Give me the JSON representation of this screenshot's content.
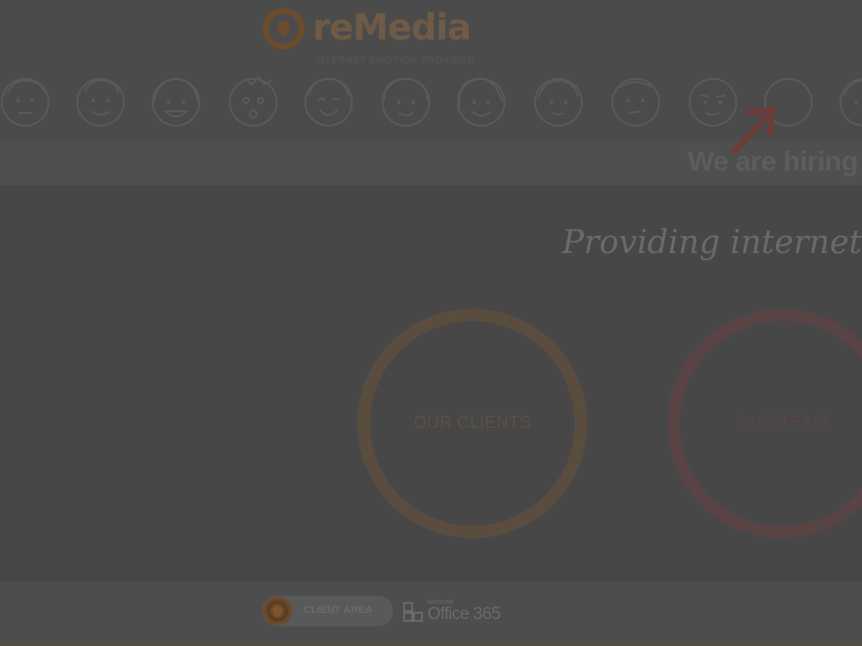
{
  "brand": {
    "name": "reMedia",
    "tagline": "INTERNET EMOTION PROVIDER",
    "accent_color": "#d0701a",
    "logo_icon": "remedia-logo-icon"
  },
  "team_faces": [
    {
      "name": "face-neutral"
    },
    {
      "name": "face-smiling"
    },
    {
      "name": "face-grinning"
    },
    {
      "name": "face-surprised"
    },
    {
      "name": "face-laughing"
    },
    {
      "name": "face-happy"
    },
    {
      "name": "face-cheerful"
    },
    {
      "name": "face-calm"
    },
    {
      "name": "face-thinking"
    },
    {
      "name": "face-winking"
    },
    {
      "name": "face-empty-placeholder"
    },
    {
      "name": "face-partial"
    }
  ],
  "hiring": {
    "text": "We are hiring",
    "arrow_icon": "arrow-up-right-icon"
  },
  "hero": {
    "tagline": "Providing internet em"
  },
  "circles": [
    {
      "label": "OUR CLIENTS",
      "color": "#c98a3a"
    },
    {
      "label": "OUR TEAM",
      "color": "#b4534a"
    }
  ],
  "footer": {
    "client_area_label": "CLIENT AREA",
    "office_small": "Microsoft",
    "office_label": "Office 365"
  }
}
